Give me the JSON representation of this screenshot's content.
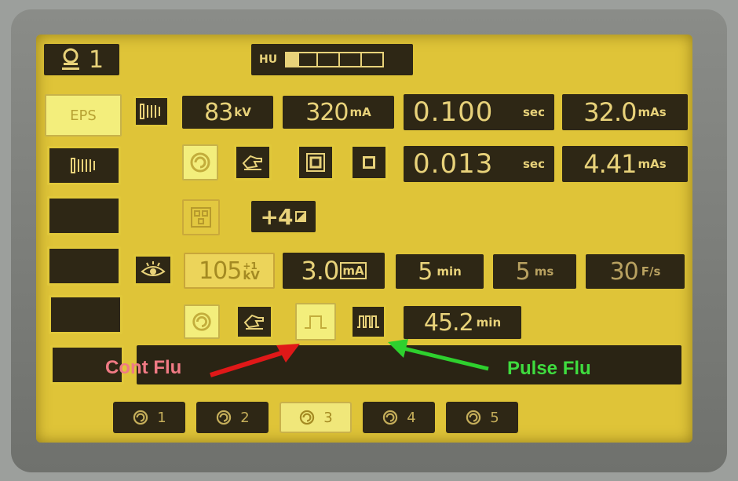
{
  "header": {
    "tube_number": "1",
    "hu_label": "HU",
    "hu_cells": 5,
    "hu_filled": 1
  },
  "sidebar": {
    "items": [
      {
        "label": "EPS",
        "icon": "",
        "active": true
      },
      {
        "label": "",
        "icon": "filter-grid-icon",
        "active": false
      },
      {
        "label": "",
        "icon": "",
        "active": false
      },
      {
        "label": "",
        "icon": "",
        "active": false
      },
      {
        "label": "",
        "icon": "",
        "active": false
      },
      {
        "label": "",
        "icon": "",
        "active": false
      }
    ]
  },
  "exposure": {
    "kv": {
      "value": "83",
      "unit": "kV"
    },
    "ma": {
      "value": "320",
      "unit": "mA"
    },
    "time": {
      "value": "0.100",
      "unit": "sec"
    },
    "mas": {
      "value": "32.0",
      "unit": "mAs"
    },
    "time2": {
      "value": "0.013",
      "unit": "sec"
    },
    "mas2": {
      "value": "4.41",
      "unit": "mAs"
    },
    "plus_value": "+4"
  },
  "fluoro": {
    "kv": {
      "value": "105",
      "unit": "kV",
      "superscript": "+1"
    },
    "ma": {
      "value": "3.0",
      "unit": "mA"
    },
    "duration": {
      "value": "5",
      "unit": "min"
    },
    "pulse_width": {
      "value": "5",
      "unit": "ms"
    },
    "frame_rate": {
      "value": "30",
      "unit": "F/s"
    },
    "total_time": {
      "value": "45.2",
      "unit": "min"
    }
  },
  "tabs": [
    {
      "label": "1",
      "active": false
    },
    {
      "label": "2",
      "active": false
    },
    {
      "label": "3",
      "active": true
    },
    {
      "label": "4",
      "active": false
    },
    {
      "label": "5",
      "active": false
    }
  ],
  "annotations": {
    "cont_flu": {
      "label": "Cont Flu",
      "color": "#f07a84"
    },
    "pulse_flu": {
      "label": "Pulse Flu",
      "color": "#3fdc3f"
    }
  },
  "colors": {
    "screen": "#dfc438",
    "panel_dark": "#2e2715",
    "digit": "#e8d27a",
    "lit": "#f3ee7c"
  }
}
